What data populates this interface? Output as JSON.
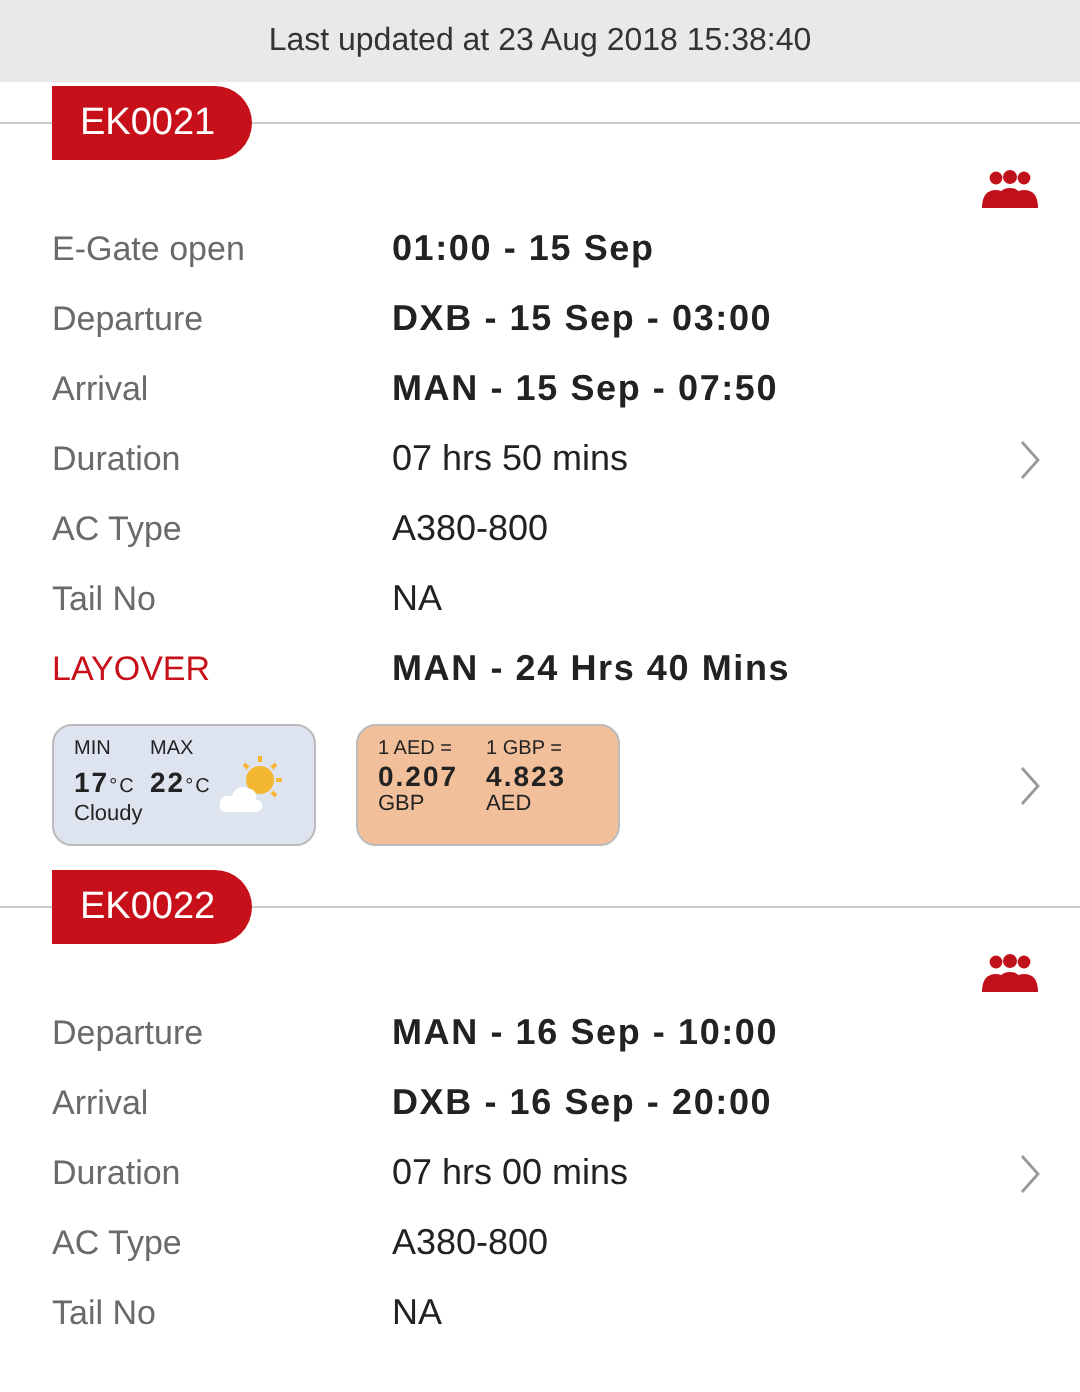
{
  "status_bar": {
    "text": "Last updated at 23 Aug 2018 15:38:40"
  },
  "flights": [
    {
      "number": "EK0021",
      "rows": [
        {
          "kind": "bold",
          "label": "E-Gate open",
          "value": "01:00 - 15 Sep"
        },
        {
          "kind": "bold",
          "label": "Departure",
          "value": "DXB - 15 Sep - 03:00"
        },
        {
          "kind": "bold",
          "label": "Arrival",
          "value": "MAN - 15 Sep - 07:50"
        },
        {
          "kind": "plain",
          "label": "Duration",
          "value": "07 hrs 50 mins"
        },
        {
          "kind": "plain",
          "label": "AC Type",
          "value": "A380-800"
        },
        {
          "kind": "plain",
          "label": "Tail No",
          "value": "NA"
        },
        {
          "kind": "layover",
          "label": "LAYOVER",
          "value": "MAN  - 24 Hrs 40 Mins"
        }
      ],
      "weather": {
        "min_label": "MIN",
        "min": "17",
        "min_unit": "°C",
        "max_label": "MAX",
        "max": "22",
        "max_unit": "°C",
        "condition": "Cloudy"
      },
      "currency": [
        {
          "head": "1 AED =",
          "value": "0.207",
          "unit": "GBP"
        },
        {
          "head": "1 GBP =",
          "value": "4.823",
          "unit": "AED"
        }
      ]
    },
    {
      "number": "EK0022",
      "rows": [
        {
          "kind": "bold",
          "label": "Departure",
          "value": "MAN - 16 Sep - 10:00"
        },
        {
          "kind": "bold",
          "label": "Arrival",
          "value": "DXB - 16 Sep - 20:00"
        },
        {
          "kind": "plain",
          "label": "Duration",
          "value": "07 hrs 00 mins"
        },
        {
          "kind": "plain",
          "label": "AC Type",
          "value": "A380-800"
        },
        {
          "kind": "plain",
          "label": "Tail No",
          "value": "NA"
        }
      ]
    }
  ]
}
